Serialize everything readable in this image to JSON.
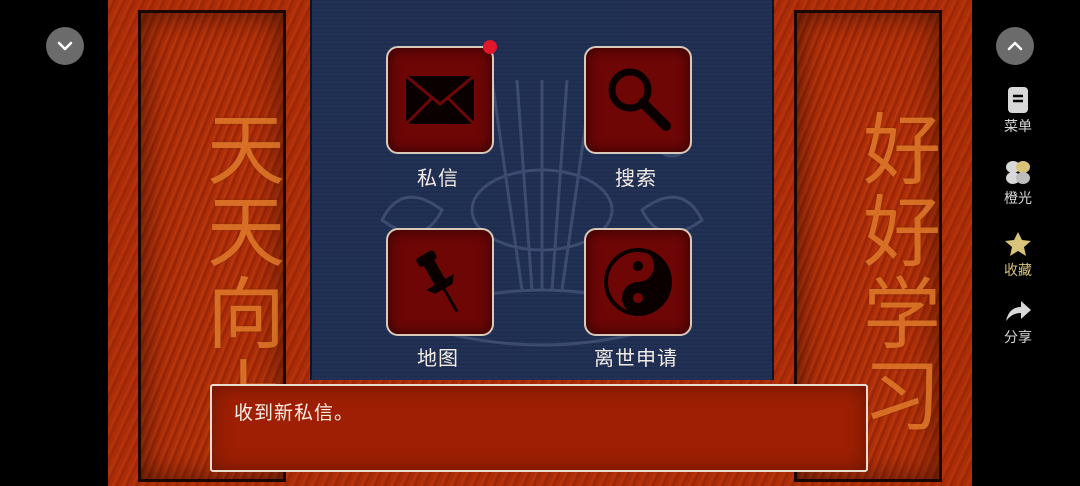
{
  "banners": {
    "left_text": "天天向上",
    "right_text": "好好学习"
  },
  "menu": {
    "items": [
      {
        "label": "私信",
        "icon": "envelope-icon",
        "has_notification": true
      },
      {
        "label": "搜索",
        "icon": "magnifier-icon",
        "has_notification": false
      },
      {
        "label": "地图",
        "icon": "pushpin-icon",
        "has_notification": false
      },
      {
        "label": "离世申请",
        "icon": "yin-yang-icon",
        "has_notification": false
      }
    ]
  },
  "dialog": {
    "text": "收到新私信。"
  },
  "sidebar": {
    "items": [
      {
        "label": "菜单",
        "icon": "menu-icon"
      },
      {
        "label": "橙光",
        "icon": "orange-light-icon"
      },
      {
        "label": "收藏",
        "icon": "star-icon"
      },
      {
        "label": "分享",
        "icon": "share-icon"
      }
    ]
  },
  "colors": {
    "tile_fill": "#6e0606",
    "board_blue": "#1f2d4f",
    "frame_red": "#a52a08",
    "notification": "#e3162a",
    "calligraphy": "#e07a2a"
  }
}
